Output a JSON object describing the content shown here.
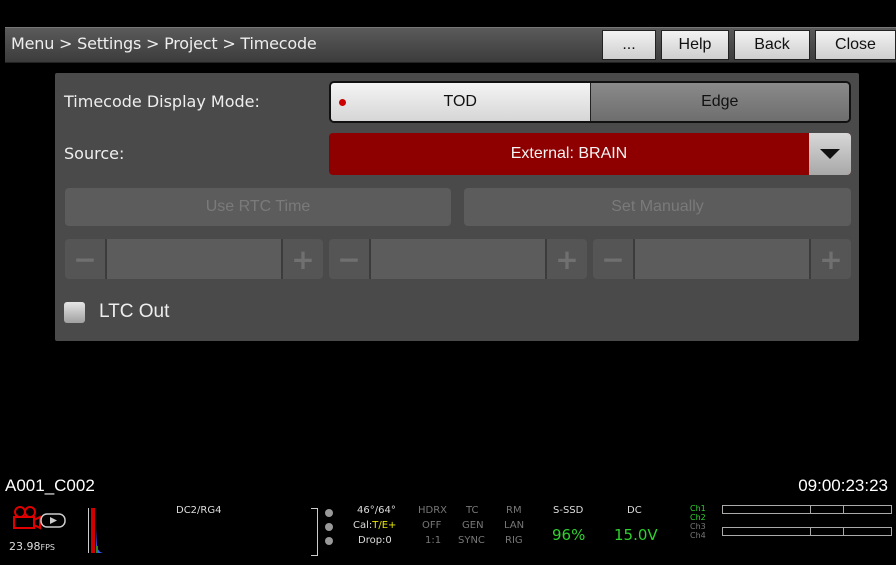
{
  "title_bar": {
    "breadcrumb": "Menu > Settings > Project > Timecode",
    "more_label": "...",
    "help_label": "Help",
    "back_label": "Back",
    "close_label": "Close"
  },
  "timecode": {
    "display_mode_label": "Timecode Display Mode:",
    "mode_options": [
      "TOD",
      "Edge"
    ],
    "mode_selected": "TOD",
    "source_label": "Source:",
    "source_value": "External: BRAIN",
    "use_rtc_label": "Use RTC Time",
    "set_manually_label": "Set Manually",
    "stepper_minus": "−",
    "stepper_plus": "+",
    "ltc_out_label": "LTC Out"
  },
  "clip": {
    "name": "A001_C002",
    "timecode": "09:00:23:23"
  },
  "status_bar": {
    "fps": "23.98",
    "fps_unit": "FPS",
    "color_science": "DC2/RG4",
    "temp": "46°/64°",
    "cal_prefix": "Cal:",
    "cal_value": "T/E+",
    "drop": "Drop:0",
    "hdrx_col": [
      "HDRX",
      "OFF",
      "1:1"
    ],
    "tc_col": [
      "TC",
      "GEN",
      "SYNC"
    ],
    "rm_col": [
      "RM",
      "LAN",
      "RIG"
    ],
    "media_label": "S-SSD",
    "media_value": "96%",
    "power_label": "DC",
    "power_value": "15.0V",
    "channels": [
      "Ch1",
      "Ch2",
      "Ch3",
      "Ch4"
    ]
  },
  "colors": {
    "accent_red": "#8e0000",
    "record_dot": "#cc0000",
    "status_green": "#2fd22f",
    "cal_yellow": "#e6e600"
  }
}
